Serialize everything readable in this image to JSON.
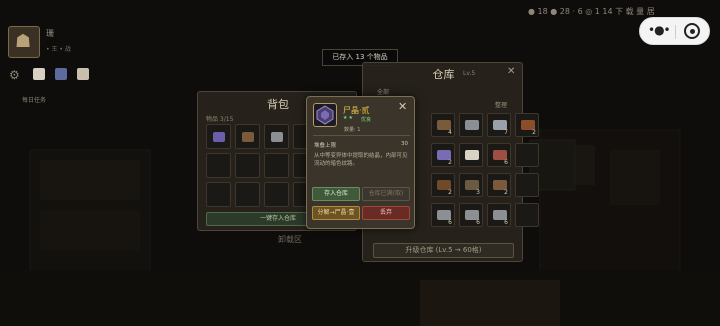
{
  "hud": {
    "player_name": "珊",
    "player_sub": "• 王 • 战",
    "daily_task": "每日任务",
    "stats_line": "● 18   ● 28   · 6   ◎ 1   14 下 载 量 居",
    "slot_colors": [
      "#d8d1c2",
      "#5b6c9c",
      "#c8bfae"
    ]
  },
  "toast": "已存入 13 个物品",
  "warehouse": {
    "title": "仓库",
    "level": "Lv.5",
    "tab_all": "全部",
    "sort_label": "整理",
    "upgrade_label": "升级仓库 (Lv.5 → 60格)",
    "items": [
      {
        "icon": "box-item-icon",
        "count": "4"
      },
      {
        "icon": "knife-icon",
        "count": ""
      },
      {
        "icon": "sword-icon",
        "count": "7"
      },
      {
        "icon": "chest-icon",
        "count": "2"
      },
      {
        "icon": "crystal-icon",
        "count": "2"
      },
      {
        "icon": "feather-icon",
        "count": ""
      },
      {
        "icon": "scroll-icon",
        "count": "6"
      },
      {
        "icon": "blank-icon",
        "count": ""
      },
      {
        "icon": "bag-item-icon",
        "count": "2"
      },
      {
        "icon": "gun-icon",
        "count": "3"
      },
      {
        "icon": "box-item-icon",
        "count": "2"
      },
      {
        "icon": "blank-icon",
        "count": ""
      },
      {
        "icon": "blade-icon",
        "count": "6"
      },
      {
        "icon": "blade-icon",
        "count": "6"
      },
      {
        "icon": "blade-icon",
        "count": "6"
      },
      {
        "icon": "blank-icon",
        "count": ""
      }
    ]
  },
  "bag": {
    "title": "背包",
    "capacity": "物品 3/15",
    "store_all_label": "一键存入仓库",
    "bottom_tab": "卸载区"
  },
  "popup": {
    "item_name": "尸晶·贰",
    "stars": "★★",
    "quality": "优良",
    "quantity": "数量: 1",
    "stack_label": "堆叠上限",
    "stack_value": "30",
    "description": "从中等变异体中提取的结晶，内部可见流动的暗色纹路。",
    "btn_store": "存入仓库",
    "btn_retrieve": "仓库已满(取)",
    "btn_dismantle": "分解→尸晶·壹",
    "btn_discard": "丢弃"
  },
  "colors": {
    "accent_gold": "#f0c845",
    "accent_green": "#7fd67a",
    "btn_green": "#3e5a38",
    "btn_orange": "#6b5325",
    "btn_red": "#6a2b24"
  }
}
